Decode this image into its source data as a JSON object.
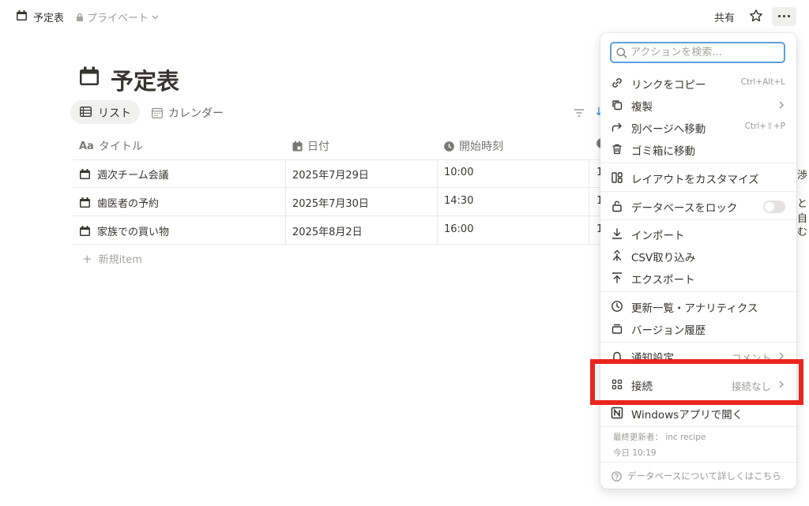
{
  "topbar": {
    "breadcrumb_title": "予定表",
    "privacy_label": "プライベート",
    "share_label": "共有"
  },
  "page": {
    "title": "予定表"
  },
  "views": {
    "list_label": "リスト",
    "calendar_label": "カレンダー"
  },
  "table": {
    "headers": {
      "title": "タイトル",
      "date": "日付",
      "time": "開始時刻"
    },
    "rows": [
      {
        "title": "週次チーム会議",
        "date": "2025年7月29日",
        "time": "10:00",
        "peek_hidden": "1",
        "peek_right": "渉"
      },
      {
        "title": "歯医者の予約",
        "date": "2025年7月30日",
        "time": "14:30",
        "peek_hidden": "1",
        "peek_right": "と自"
      },
      {
        "title": "家族での買い物",
        "date": "2025年8月2日",
        "time": "16:00",
        "peek_hidden": "1",
        "peek_right": "む"
      }
    ],
    "new_item_label": "新規item"
  },
  "menu": {
    "search_placeholder": "アクションを検索...",
    "items": {
      "copy_link": {
        "label": "リンクをコピー",
        "shortcut": "Ctrl+Alt+L"
      },
      "duplicate": {
        "label": "複製"
      },
      "move": {
        "label": "別ページへ移動",
        "shortcut": "Ctrl+⇧+P"
      },
      "trash": {
        "label": "ゴミ箱に移動"
      },
      "customize": {
        "label": "レイアウトをカスタマイズ"
      },
      "lock": {
        "label": "データベースをロック",
        "toggle_on": false
      },
      "import": {
        "label": "インポート"
      },
      "csv": {
        "label": "CSV取り込み"
      },
      "export": {
        "label": "エクスポート"
      },
      "updates": {
        "label": "更新一覧・アナリティクス"
      },
      "history": {
        "label": "バージョン履歴"
      },
      "notify": {
        "label": "通知設定",
        "value": "コメント"
      },
      "connect": {
        "label": "接続",
        "value": "接続なし"
      },
      "windows": {
        "label": "Windowsアプリで開く"
      }
    },
    "last_edited": "最終更新者： inc recipe",
    "last_edited_time": "今日 10:19",
    "learn_more": "データベースについて詳しくはこちら"
  },
  "colors": {
    "highlight": "#e8261d",
    "accent": "#2383e2"
  }
}
